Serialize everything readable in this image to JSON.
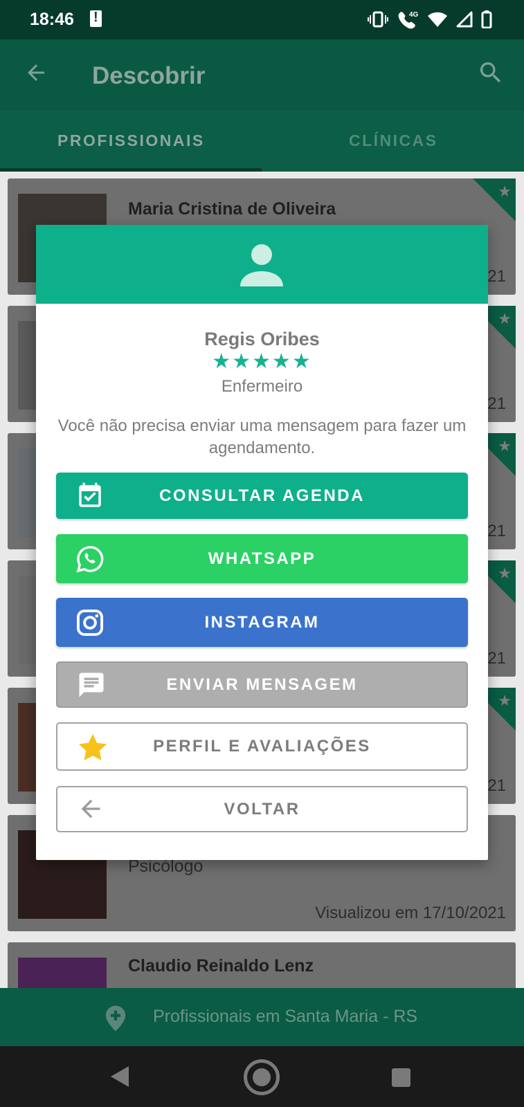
{
  "status_bar": {
    "time": "18:46",
    "network": "4G",
    "icons": [
      "alert-icon",
      "vibrate-icon",
      "volte-call-icon",
      "wifi-icon",
      "signal-icon",
      "battery-icon"
    ]
  },
  "app_bar": {
    "title": "Descobrir",
    "back_icon": "arrow-back-icon",
    "search_icon": "search-icon"
  },
  "tabs": [
    {
      "label": "PROFISSIONAIS",
      "selected": true
    },
    {
      "label": "CLÍNICAS",
      "selected": false
    }
  ],
  "list": {
    "cards": [
      {
        "name": "Maria Cristina de Oliveira",
        "date_suffix": "21"
      },
      {
        "name": "",
        "date_suffix": "21"
      },
      {
        "name": "",
        "date_suffix": "21"
      },
      {
        "name": "",
        "date_suffix": "21"
      },
      {
        "name": "",
        "date_suffix": "21"
      },
      {
        "stars": "★★★★★",
        "role": "Psicólogo",
        "date": "Visualizou em 17/10/2021"
      },
      {
        "name": "Claudio Reinaldo Lenz"
      }
    ]
  },
  "bottom_bar": {
    "location_text": "Profissionais em Santa Maria - RS"
  },
  "dialog": {
    "name": "Regis Oribes",
    "rating_stars": "★★★★★",
    "role": "Enfermeiro",
    "message": "Você não precisa enviar uma mensagem para fazer um agendamento.",
    "buttons": {
      "agenda": "CONSULTAR AGENDA",
      "whatsapp": "WHATSAPP",
      "instagram": "INSTAGRAM",
      "message": "ENVIAR MENSAGEM",
      "profile": "PERFIL E AVALIAÇÕES",
      "back": "VOLTAR"
    }
  },
  "colors": {
    "primary": "#0db08b",
    "whatsapp": "#2bd165",
    "instagram": "#3a72cc",
    "disabled": "#aeaeae",
    "star_gold": "#f7c21a"
  }
}
